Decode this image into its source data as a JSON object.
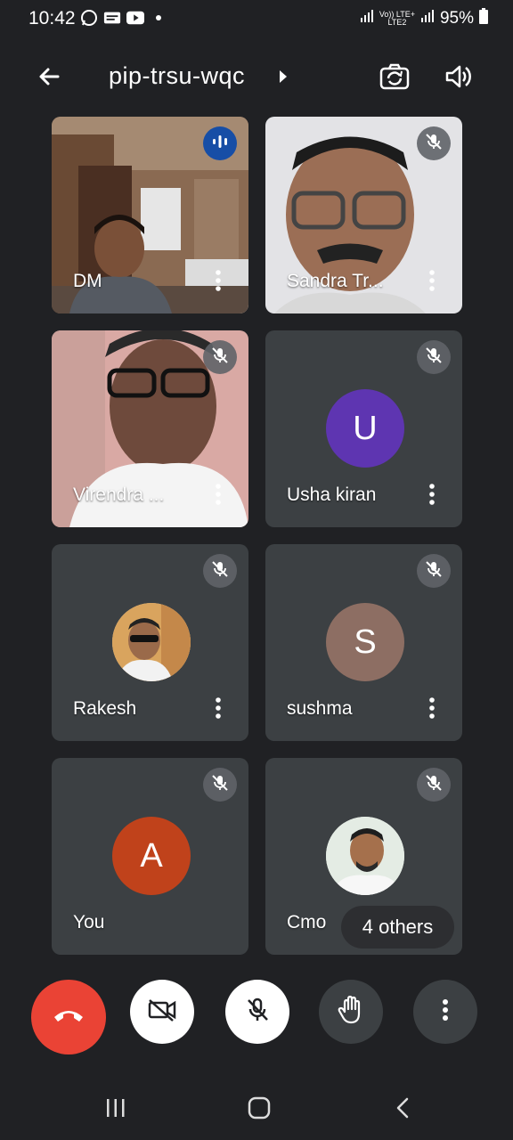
{
  "status_bar": {
    "time": "10:42",
    "network_top": "Vo)) LTE+",
    "network_bottom": "LTE2",
    "battery": "95%"
  },
  "header": {
    "meeting_code": "pip-trsu-wqc"
  },
  "participants": [
    {
      "name": "DM",
      "type": "video",
      "muted": false,
      "speaking": true
    },
    {
      "name": "Sandra Tr...",
      "type": "video",
      "muted": true
    },
    {
      "name": "Virendra ...",
      "type": "video",
      "muted": true
    },
    {
      "name": "Usha kiran",
      "type": "initial",
      "initial": "U",
      "avatar_color": "#5e35b1",
      "muted": true
    },
    {
      "name": "Rakesh",
      "type": "photo",
      "muted": true
    },
    {
      "name": "sushma",
      "type": "initial",
      "initial": "S",
      "avatar_color": "#8d6e63",
      "muted": true
    },
    {
      "name": "You",
      "type": "initial",
      "initial": "A",
      "avatar_color": "#c0421b",
      "muted": true
    },
    {
      "name": "Cmo",
      "type": "photo",
      "muted": true
    }
  ],
  "others_label": "4 others",
  "controls": {
    "end_call_color": "#ea4335",
    "items": [
      "end-call",
      "camera-off",
      "mic-off",
      "raise-hand",
      "more-options"
    ]
  },
  "icons": [
    "back-arrow-icon",
    "switch-camera-icon",
    "speaker-icon",
    "mic-off-icon",
    "audio-wave-icon",
    "more-vert-icon"
  ]
}
